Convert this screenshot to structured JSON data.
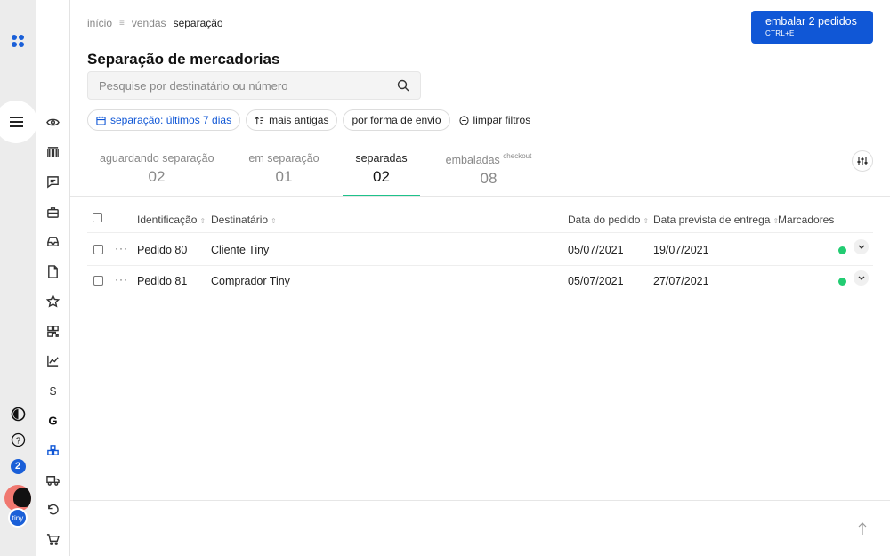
{
  "breadcrumb": {
    "home": "início",
    "section": "vendas",
    "current": "separação"
  },
  "cta": {
    "label": "embalar 2 pedidos",
    "shortcut": "CTRL+E",
    "color": "#1057d6"
  },
  "page": {
    "title": "Separação de mercadorias"
  },
  "search": {
    "placeholder": "Pesquise por destinatário ou número",
    "value": ""
  },
  "filters": {
    "period": "separação: últimos 7 dias",
    "sort": "mais antigas",
    "shipping": "por forma de envio",
    "clear": "limpar filtros"
  },
  "tabs": [
    {
      "label": "aguardando separação",
      "count": "02"
    },
    {
      "label": "em separação",
      "count": "01"
    },
    {
      "label": "separadas",
      "count": "02",
      "active": true
    },
    {
      "label": "embaladas",
      "sup": "checkout",
      "count": "08"
    }
  ],
  "table": {
    "columns": {
      "id": "Identificação",
      "recipient": "Destinatário",
      "order_date": "Data do pedido",
      "delivery_date": "Data prevista de entrega",
      "markers": "Marcadores"
    },
    "rows": [
      {
        "id": "Pedido 80",
        "recipient": "Cliente Tiny",
        "order_date": "05/07/2021",
        "delivery_date": "19/07/2021",
        "status_color": "#22cc72"
      },
      {
        "id": "Pedido 81",
        "recipient": "Comprador Tiny",
        "order_date": "05/07/2021",
        "delivery_date": "27/07/2021",
        "status_color": "#22cc72"
      }
    ]
  },
  "rail": {
    "notifications": "2",
    "brand": "tiny"
  },
  "colors": {
    "accent": "#1057d6",
    "active_tab": "#1ec28b",
    "status_ok": "#22cc72"
  }
}
